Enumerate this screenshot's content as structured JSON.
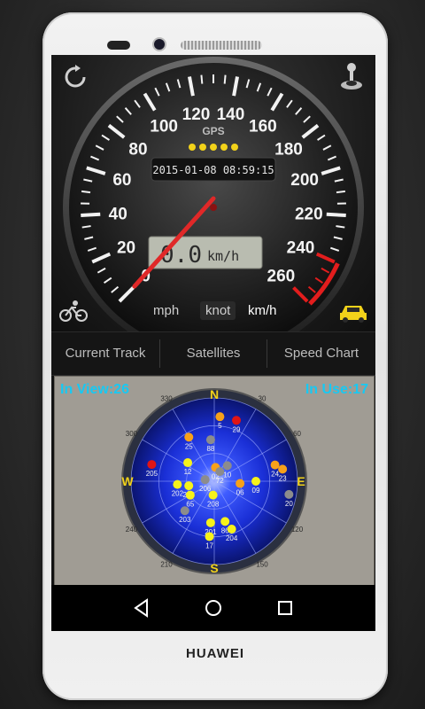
{
  "device": {
    "brand": "HUAWEI"
  },
  "speedometer": {
    "gps_label": "GPS",
    "datetime": "2015-01-08 08:59:15",
    "speed_value": "0.0",
    "speed_unit": "km/h",
    "ticks": [
      "0",
      "20",
      "40",
      "60",
      "80",
      "100",
      "120",
      "140",
      "160",
      "180",
      "200",
      "220",
      "240",
      "260"
    ],
    "needle_value": 0,
    "max_value": 260,
    "gps_signal_dots": 5
  },
  "units": {
    "mph": "mph",
    "knot": "knot",
    "kmh": "km/h",
    "selected": "km/h"
  },
  "tabs": [
    {
      "label": "Current Track",
      "active": false
    },
    {
      "label": "Satellites",
      "active": true
    },
    {
      "label": "Speed Chart",
      "active": false
    }
  ],
  "satellites": {
    "in_view": "In View:26",
    "in_use": "In Use:17",
    "compass_labels": {
      "N": "N",
      "E": "E",
      "S": "S",
      "W": "W"
    },
    "degree_labels": [
      "330",
      "30",
      "60",
      "120",
      "150",
      "210",
      "240",
      "300"
    ],
    "items": [
      {
        "id": "25",
        "az": 330,
        "el": 35,
        "color": "orange"
      },
      {
        "id": "88",
        "az": 355,
        "el": 45,
        "color": "gray"
      },
      {
        "id": "29",
        "az": 20,
        "el": 20,
        "color": "red"
      },
      {
        "id": "205",
        "az": 285,
        "el": 20,
        "color": "red"
      },
      {
        "id": "12",
        "az": 305,
        "el": 55,
        "color": "yellow"
      },
      {
        "id": "202",
        "az": 265,
        "el": 50,
        "color": "yellow"
      },
      {
        "id": "209",
        "az": 260,
        "el": 62,
        "color": "yellow"
      },
      {
        "id": "65",
        "az": 240,
        "el": 60,
        "color": "yellow"
      },
      {
        "id": "203",
        "az": 225,
        "el": 45,
        "color": "gray"
      },
      {
        "id": "206",
        "az": 280,
        "el": 80,
        "color": "gray"
      },
      {
        "id": "02",
        "az": 5,
        "el": 75,
        "color": "orange"
      },
      {
        "id": "10",
        "az": 40,
        "el": 68,
        "color": "gray"
      },
      {
        "id": "72",
        "az": 30,
        "el": 78,
        "color": "gray"
      },
      {
        "id": "208",
        "az": 185,
        "el": 75,
        "color": "yellow"
      },
      {
        "id": "06",
        "az": 95,
        "el": 62,
        "color": "orange"
      },
      {
        "id": "09",
        "az": 90,
        "el": 45,
        "color": "yellow"
      },
      {
        "id": "24",
        "az": 75,
        "el": 22,
        "color": "orange"
      },
      {
        "id": "23",
        "az": 80,
        "el": 15,
        "color": "orange"
      },
      {
        "id": "20",
        "az": 100,
        "el": 8,
        "color": "gray"
      },
      {
        "id": "201",
        "az": 185,
        "el": 45,
        "color": "yellow"
      },
      {
        "id": "86",
        "az": 165,
        "el": 45,
        "color": "yellow"
      },
      {
        "id": "204",
        "az": 160,
        "el": 35,
        "color": "yellow"
      },
      {
        "id": "17",
        "az": 185,
        "el": 30,
        "color": "yellow"
      },
      {
        "id": "5",
        "az": 5,
        "el": 20,
        "color": "orange"
      }
    ]
  },
  "navbar": {
    "back": "back-icon",
    "home": "home-icon",
    "recents": "recents-icon"
  }
}
